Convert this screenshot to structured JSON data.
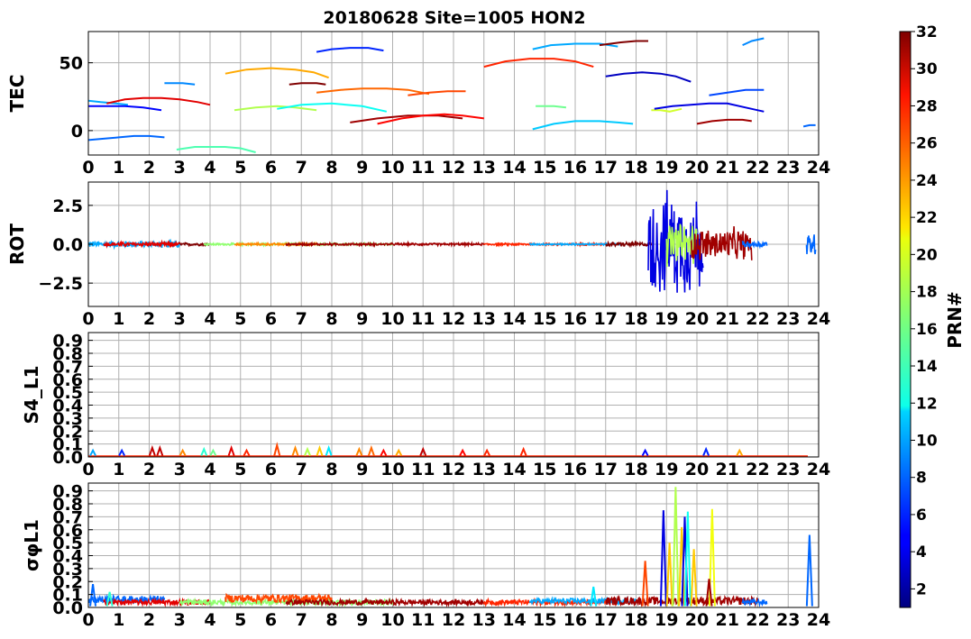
{
  "title": "20180628 Site=1005 HON2",
  "colorbar": {
    "label": "PRN#",
    "min": 1,
    "max": 32,
    "ticks": [
      2,
      4,
      6,
      8,
      10,
      12,
      14,
      16,
      18,
      20,
      22,
      24,
      26,
      28,
      30,
      32
    ]
  },
  "chart_data": [
    {
      "type": "line",
      "panel": "TEC",
      "ylabel": "TEC",
      "xlim": [
        0,
        24
      ],
      "ylim": [
        -18,
        73
      ],
      "yticks": [
        0,
        50
      ],
      "xticks": [
        0,
        1,
        2,
        3,
        4,
        5,
        6,
        7,
        8,
        9,
        10,
        11,
        12,
        13,
        14,
        15,
        16,
        17,
        18,
        19,
        20,
        21,
        22,
        23,
        24
      ],
      "grid": true,
      "series": [
        {
          "prn": 8,
          "x": [
            0.0,
            0.5,
            1.0,
            1.5,
            2.0,
            2.5
          ],
          "y": [
            -7,
            -6,
            -5,
            -4,
            -4,
            -5
          ]
        },
        {
          "prn": 10,
          "x": [
            0.0,
            0.4,
            0.9,
            1.3
          ],
          "y": [
            22,
            21,
            20,
            19
          ]
        },
        {
          "prn": 5,
          "x": [
            0.0,
            0.6,
            1.2,
            1.8,
            2.4
          ],
          "y": [
            18,
            18,
            18,
            17,
            15
          ]
        },
        {
          "prn": 29,
          "x": [
            0.6,
            1.2,
            1.8,
            2.4,
            3.0,
            3.6,
            4.0
          ],
          "y": [
            20,
            23,
            24,
            24,
            23,
            21,
            19
          ]
        },
        {
          "prn": 9,
          "x": [
            2.5,
            2.8,
            3.1,
            3.5
          ],
          "y": [
            35,
            35,
            35,
            34
          ]
        },
        {
          "prn": 15,
          "x": [
            2.9,
            3.5,
            4.0,
            4.5,
            5.0,
            5.5
          ],
          "y": [
            -14,
            -12,
            -12,
            -12,
            -13,
            -16
          ]
        },
        {
          "prn": 23,
          "x": [
            4.5,
            5.2,
            6.0,
            6.8,
            7.4,
            7.9
          ],
          "y": [
            42,
            45,
            46,
            45,
            43,
            39
          ]
        },
        {
          "prn": 18,
          "x": [
            4.8,
            5.5,
            6.2,
            6.8,
            7.5
          ],
          "y": [
            15,
            17,
            18,
            17,
            15
          ]
        },
        {
          "prn": 32,
          "x": [
            6.6,
            7.0,
            7.5,
            7.8
          ],
          "y": [
            34,
            35,
            35,
            34
          ]
        },
        {
          "prn": 13,
          "x": [
            6.2,
            7.0,
            8.0,
            9.0,
            9.8
          ],
          "y": [
            16,
            19,
            20,
            18,
            14
          ]
        },
        {
          "prn": 6,
          "x": [
            7.5,
            8.0,
            8.6,
            9.2,
            9.7
          ],
          "y": [
            58,
            60,
            61,
            61,
            59
          ]
        },
        {
          "prn": 25,
          "x": [
            7.5,
            8.3,
            9.0,
            9.8,
            10.5,
            11.2
          ],
          "y": [
            28,
            30,
            31,
            31,
            30,
            27
          ]
        },
        {
          "prn": 31,
          "x": [
            8.6,
            9.5,
            10.5,
            11.5,
            12.3
          ],
          "y": [
            6,
            9,
            11,
            11,
            9
          ]
        },
        {
          "prn": 28,
          "x": [
            9.5,
            10.3,
            11.0,
            11.7,
            12.3,
            13.0
          ],
          "y": [
            5,
            9,
            11,
            12,
            11,
            9
          ]
        },
        {
          "prn": 26,
          "x": [
            10.5,
            11.2,
            11.8,
            12.4
          ],
          "y": [
            26,
            28,
            29,
            29
          ]
        },
        {
          "prn": 27,
          "x": [
            13.0,
            13.7,
            14.5,
            15.3,
            16.0,
            16.6
          ],
          "y": [
            47,
            51,
            53,
            53,
            51,
            47
          ]
        },
        {
          "prn": 10,
          "x": [
            14.6,
            15.2,
            16.0,
            16.8,
            17.4
          ],
          "y": [
            60,
            63,
            64,
            64,
            62
          ]
        },
        {
          "prn": 16,
          "x": [
            14.7,
            15.0,
            15.3,
            15.7
          ],
          "y": [
            18,
            18,
            18,
            17
          ]
        },
        {
          "prn": 11,
          "x": [
            14.6,
            15.3,
            16.0,
            16.8,
            17.4,
            17.9
          ],
          "y": [
            1,
            5,
            7,
            7,
            6,
            5
          ]
        },
        {
          "prn": 32,
          "x": [
            16.8,
            17.5,
            18.0,
            18.4
          ],
          "y": [
            63,
            65,
            66,
            66
          ]
        },
        {
          "prn": 3,
          "x": [
            17.0,
            17.6,
            18.2,
            18.8,
            19.3,
            19.8
          ],
          "y": [
            40,
            42,
            43,
            42,
            40,
            36
          ]
        },
        {
          "prn": 19,
          "x": [
            18.5,
            18.8,
            19.1,
            19.5
          ],
          "y": [
            15,
            15,
            14,
            16
          ]
        },
        {
          "prn": 4,
          "x": [
            18.6,
            19.2,
            19.8,
            20.4,
            21.0,
            21.6,
            22.2
          ],
          "y": [
            16,
            18,
            19,
            20,
            20,
            17,
            14
          ]
        },
        {
          "prn": 7,
          "x": [
            20.4,
            21.0,
            21.6,
            22.2
          ],
          "y": [
            26,
            28,
            30,
            30
          ]
        },
        {
          "prn": 31,
          "x": [
            20.0,
            20.5,
            21.0,
            21.5,
            21.8
          ],
          "y": [
            5,
            7,
            8,
            8,
            7
          ]
        },
        {
          "prn": 9,
          "x": [
            21.5,
            21.8,
            22.2
          ],
          "y": [
            63,
            66,
            68
          ]
        },
        {
          "prn": 8,
          "x": [
            23.5,
            23.7,
            23.9
          ],
          "y": [
            3,
            4,
            4
          ]
        }
      ]
    },
    {
      "type": "line",
      "panel": "ROT",
      "ylabel": "ROT",
      "xlim": [
        0,
        24
      ],
      "ylim": [
        -4,
        4
      ],
      "yticks": [
        -2.5,
        0.0,
        2.5
      ],
      "ytick_labels": [
        "−2.5",
        "0.0",
        "2.5"
      ],
      "xticks": [
        0,
        1,
        2,
        3,
        4,
        5,
        6,
        7,
        8,
        9,
        10,
        11,
        12,
        13,
        14,
        15,
        16,
        17,
        18,
        19,
        20,
        21,
        22,
        23,
        24
      ],
      "grid": true,
      "noise_spans": [
        {
          "prn": 10,
          "x0": 0.0,
          "x1": 3.0,
          "amp": 0.25
        },
        {
          "prn": 29,
          "x0": 0.5,
          "x1": 3.0,
          "amp": 0.15
        },
        {
          "prn": 32,
          "x0": 3.0,
          "x1": 4.0,
          "amp": 0.1
        },
        {
          "prn": 17,
          "x0": 3.8,
          "x1": 10.0,
          "amp": 0.08
        },
        {
          "prn": 24,
          "x0": 4.8,
          "x1": 7.5,
          "amp": 0.08
        },
        {
          "prn": 31,
          "x0": 6.5,
          "x1": 13.0,
          "amp": 0.08
        },
        {
          "prn": 27,
          "x0": 13.0,
          "x1": 17.0,
          "amp": 0.08
        },
        {
          "prn": 10,
          "x0": 14.5,
          "x1": 17.5,
          "amp": 0.06
        },
        {
          "prn": 32,
          "x0": 17.0,
          "x1": 18.5,
          "amp": 0.15
        },
        {
          "prn": 4,
          "x0": 18.4,
          "x1": 20.2,
          "amp": 3.8
        },
        {
          "prn": 18,
          "x0": 19.0,
          "x1": 20.0,
          "amp": 1.6
        },
        {
          "prn": 31,
          "x0": 19.8,
          "x1": 21.8,
          "amp": 1.2
        },
        {
          "prn": 8,
          "x0": 21.5,
          "x1": 22.3,
          "amp": 0.25
        },
        {
          "prn": 8,
          "x0": 23.6,
          "x1": 23.9,
          "amp": 0.9
        }
      ]
    },
    {
      "type": "line",
      "panel": "S4_L1",
      "ylabel": "S4_L1",
      "xlim": [
        0,
        24
      ],
      "ylim": [
        0,
        0.96
      ],
      "yticks": [
        0.0,
        0.1,
        0.2,
        0.3,
        0.4,
        0.5,
        0.6,
        0.7,
        0.8,
        0.9
      ],
      "xticks": [
        0,
        1,
        2,
        3,
        4,
        5,
        6,
        7,
        8,
        9,
        10,
        11,
        12,
        13,
        14,
        15,
        16,
        17,
        18,
        19,
        20,
        21,
        22,
        23,
        24
      ],
      "grid": true,
      "spikes": [
        {
          "prn": 10,
          "x": 0.15,
          "y": 0.05
        },
        {
          "prn": 6,
          "x": 1.1,
          "y": 0.05
        },
        {
          "prn": 30,
          "x": 2.1,
          "y": 0.07
        },
        {
          "prn": 30,
          "x": 2.35,
          "y": 0.07
        },
        {
          "prn": 24,
          "x": 3.1,
          "y": 0.05
        },
        {
          "prn": 14,
          "x": 3.8,
          "y": 0.06
        },
        {
          "prn": 16,
          "x": 4.1,
          "y": 0.05
        },
        {
          "prn": 29,
          "x": 4.7,
          "y": 0.07
        },
        {
          "prn": 27,
          "x": 5.2,
          "y": 0.05
        },
        {
          "prn": 26,
          "x": 6.2,
          "y": 0.09
        },
        {
          "prn": 24,
          "x": 6.8,
          "y": 0.07
        },
        {
          "prn": 18,
          "x": 7.2,
          "y": 0.06
        },
        {
          "prn": 22,
          "x": 7.6,
          "y": 0.07
        },
        {
          "prn": 12,
          "x": 7.9,
          "y": 0.07
        },
        {
          "prn": 24,
          "x": 8.9,
          "y": 0.06
        },
        {
          "prn": 25,
          "x": 9.3,
          "y": 0.07
        },
        {
          "prn": 28,
          "x": 9.7,
          "y": 0.05
        },
        {
          "prn": 23,
          "x": 10.2,
          "y": 0.05
        },
        {
          "prn": 30,
          "x": 11.0,
          "y": 0.06
        },
        {
          "prn": 28,
          "x": 12.3,
          "y": 0.05
        },
        {
          "prn": 27,
          "x": 13.1,
          "y": 0.05
        },
        {
          "prn": 27,
          "x": 14.3,
          "y": 0.06
        },
        {
          "prn": 5,
          "x": 18.3,
          "y": 0.05
        },
        {
          "prn": 6,
          "x": 20.3,
          "y": 0.06
        },
        {
          "prn": 23,
          "x": 21.4,
          "y": 0.05
        }
      ]
    },
    {
      "type": "line",
      "panel": "sigma_phi_L1",
      "ylabel": "σφL1",
      "xlim": [
        0,
        24
      ],
      "ylim": [
        0,
        0.96
      ],
      "yticks": [
        0.0,
        0.1,
        0.2,
        0.3,
        0.4,
        0.5,
        0.6,
        0.7,
        0.8,
        0.9
      ],
      "xticks": [
        0,
        1,
        2,
        3,
        4,
        5,
        6,
        7,
        8,
        9,
        10,
        11,
        12,
        13,
        14,
        15,
        16,
        17,
        18,
        19,
        20,
        21,
        22,
        23,
        24
      ],
      "grid": true,
      "baseline_spans": [
        {
          "prn": 8,
          "x0": 0.0,
          "x1": 2.5,
          "level": 0.06,
          "amp": 0.03
        },
        {
          "prn": 29,
          "x0": 0.5,
          "x1": 4.0,
          "level": 0.04,
          "amp": 0.02
        },
        {
          "prn": 17,
          "x0": 3.0,
          "x1": 10.0,
          "level": 0.04,
          "amp": 0.02
        },
        {
          "prn": 26,
          "x0": 4.5,
          "x1": 8.0,
          "level": 0.07,
          "amp": 0.03
        },
        {
          "prn": 31,
          "x0": 6.5,
          "x1": 13.0,
          "level": 0.04,
          "amp": 0.02
        },
        {
          "prn": 27,
          "x0": 13.0,
          "x1": 17.5,
          "level": 0.04,
          "amp": 0.02
        },
        {
          "prn": 10,
          "x0": 14.5,
          "x1": 18.0,
          "level": 0.05,
          "amp": 0.02
        },
        {
          "prn": 31,
          "x0": 17.0,
          "x1": 22.0,
          "level": 0.05,
          "amp": 0.03
        },
        {
          "prn": 8,
          "x0": 21.5,
          "x1": 22.3,
          "level": 0.04,
          "amp": 0.02
        }
      ],
      "spikes": [
        {
          "prn": 8,
          "x": 0.15,
          "y": 0.18
        },
        {
          "prn": 14,
          "x": 0.7,
          "y": 0.12
        },
        {
          "prn": 12,
          "x": 16.6,
          "y": 0.16
        },
        {
          "prn": 26,
          "x": 18.3,
          "y": 0.36
        },
        {
          "prn": 4,
          "x": 18.9,
          "y": 0.75
        },
        {
          "prn": 22,
          "x": 19.1,
          "y": 0.5
        },
        {
          "prn": 18,
          "x": 19.3,
          "y": 0.93
        },
        {
          "prn": 22,
          "x": 19.5,
          "y": 0.62
        },
        {
          "prn": 4,
          "x": 19.6,
          "y": 0.7
        },
        {
          "prn": 13,
          "x": 19.7,
          "y": 0.74
        },
        {
          "prn": 22,
          "x": 19.9,
          "y": 0.45
        },
        {
          "prn": 20,
          "x": 20.5,
          "y": 0.76
        },
        {
          "prn": 31,
          "x": 20.4,
          "y": 0.22
        },
        {
          "prn": 8,
          "x": 23.7,
          "y": 0.56
        }
      ]
    }
  ]
}
